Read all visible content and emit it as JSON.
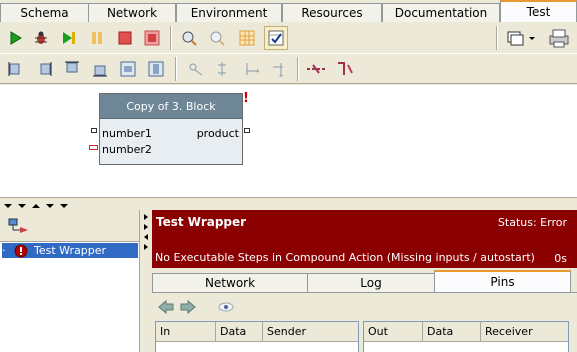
{
  "tabs": [
    "Schema",
    "Network",
    "Environment",
    "Resources",
    "Documentation",
    "Test"
  ],
  "active_tab": "Test",
  "toolbar_row1": [
    "run-icon",
    "debug-icon",
    "step-icon",
    "pause-icon",
    "stop-icon",
    "reset-icon",
    "zoom-in-icon",
    "zoom-out-icon",
    "grid-icon",
    "checklist-icon",
    "windows-dropdown-icon",
    "print-icon"
  ],
  "toolbar_row2": [
    "align-left-icon",
    "align-right-icon",
    "align-top-icon",
    "align-bottom-icon",
    "center-h-icon",
    "center-v-icon",
    "distribute-icon",
    "route-icon",
    "connect-icon",
    "connect-alt-icon",
    "disconnect-icon",
    "link-icon"
  ],
  "block": {
    "title": "Copy of 3. Block",
    "inputs": [
      "number1",
      "number2"
    ],
    "outputs": [
      "product"
    ],
    "warning": "!"
  },
  "tree": {
    "item_label": "Test Wrapper"
  },
  "status": {
    "title": "Test Wrapper",
    "state": "Status: Error",
    "message": "No Executable Steps in Compound Action (Missing inputs / autostart)",
    "time": "0s",
    "bg_color": "#8b0000"
  },
  "lower_tabs": [
    "Network",
    "Log",
    "Pins"
  ],
  "active_lower_tab": "Pins",
  "pins": {
    "in_columns": [
      "In",
      "Data",
      "Sender"
    ],
    "out_columns": [
      "Out",
      "Data",
      "Receiver"
    ]
  }
}
